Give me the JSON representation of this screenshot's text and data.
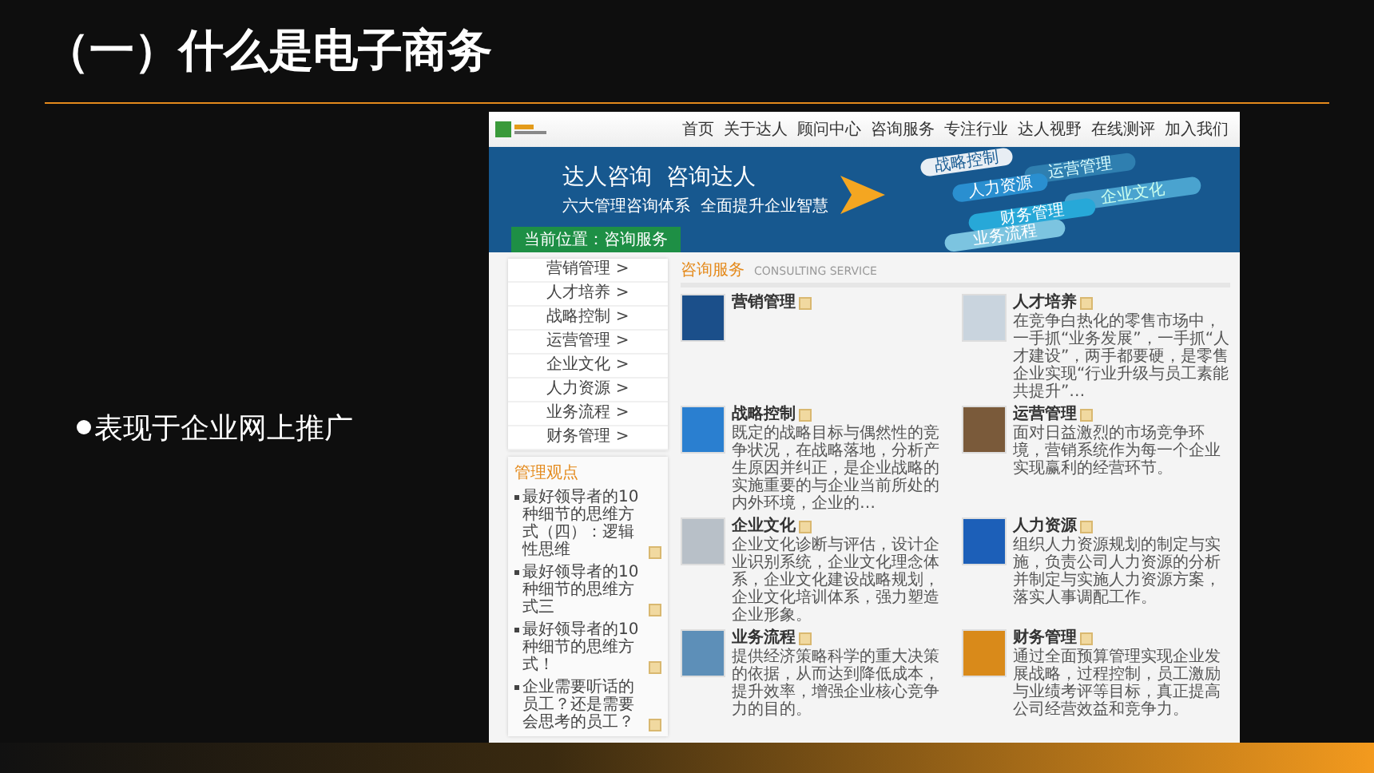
{
  "slide": {
    "title": "（一）什么是电子商务",
    "bullets": [
      "表现于企业网上推广"
    ]
  },
  "website": {
    "nav": [
      "首页",
      "关于达人",
      "顾问中心",
      "咨询服务",
      "专注行业",
      "达人视野",
      "在线测评",
      "加入我们"
    ],
    "banner": {
      "headline": "达人咨询  咨询达人",
      "subline": "六大管理咨询体系  全面提升企业智慧",
      "ribbons": [
        "战略控制",
        "运营管理",
        "人力资源",
        "企业文化",
        "财务管理",
        "业务流程"
      ],
      "breadcrumb": "当前位置：咨询服务"
    },
    "side_menu": [
      {
        "label": "营销管理",
        "arrow": ">"
      },
      {
        "label": "人才培养",
        "arrow": ">"
      },
      {
        "label": "战略控制",
        "arrow": ">"
      },
      {
        "label": "运营管理",
        "arrow": ">"
      },
      {
        "label": "企业文化",
        "arrow": ">"
      },
      {
        "label": "人力资源",
        "arrow": ">"
      },
      {
        "label": "业务流程",
        "arrow": ">"
      },
      {
        "label": "财务管理",
        "arrow": ">"
      }
    ],
    "news": {
      "title": "管理观点",
      "items": [
        "最好领导者的10种细节的思维方式（四）：逻辑性思维",
        "最好领导者的10种细节的思维方式三",
        "最好领导者的10种细节的思维方式！",
        "企业需要听话的员工？还是需要会思考的员工？"
      ]
    },
    "services": {
      "title": "咨询服务",
      "subtitle": "CONSULTING SERVICE",
      "items": [
        {
          "title": "营销管理"
        },
        {
          "title": "人才培养",
          "text": "在竞争白热化的零售市场中，一手抓“业务发展”，一手抓“人才建设”，两手都要硬，是零售企业实现“行业升级与员工素能共提升”…"
        },
        {
          "title": "战略控制",
          "text": "既定的战略目标与偶然性的竞争状况，在战略落地，分析产生原因并纠正，是企业战略的实施重要的与企业当前所处的内外环境，企业的…"
        },
        {
          "title": "运营管理",
          "text": "面对日益激烈的市场竞争环境，营销系统作为每一个企业实现赢利的经营环节。"
        },
        {
          "title": "企业文化",
          "text": "企业文化诊断与评估，设计企业识别系统，企业文化理念体系，企业文化建设战略规划，企业文化培训体系，强力塑造企业形象。"
        },
        {
          "title": "人力资源",
          "text": "组织人力资源规划的制定与实施，负责公司人力资源的分析并制定与实施人力资源方案，落实人事调配工作。"
        },
        {
          "title": "业务流程",
          "text": "提供经济策略科学的重大决策的依据，从而达到降低成本，提升效率，增强企业核心竞争力的目的。"
        },
        {
          "title": "财务管理",
          "text": "通过全面预算管理实现企业发展战略，过程控制，员工激励与业绩考评等目标，真正提高公司经营效益和竞争力。"
        }
      ]
    }
  }
}
